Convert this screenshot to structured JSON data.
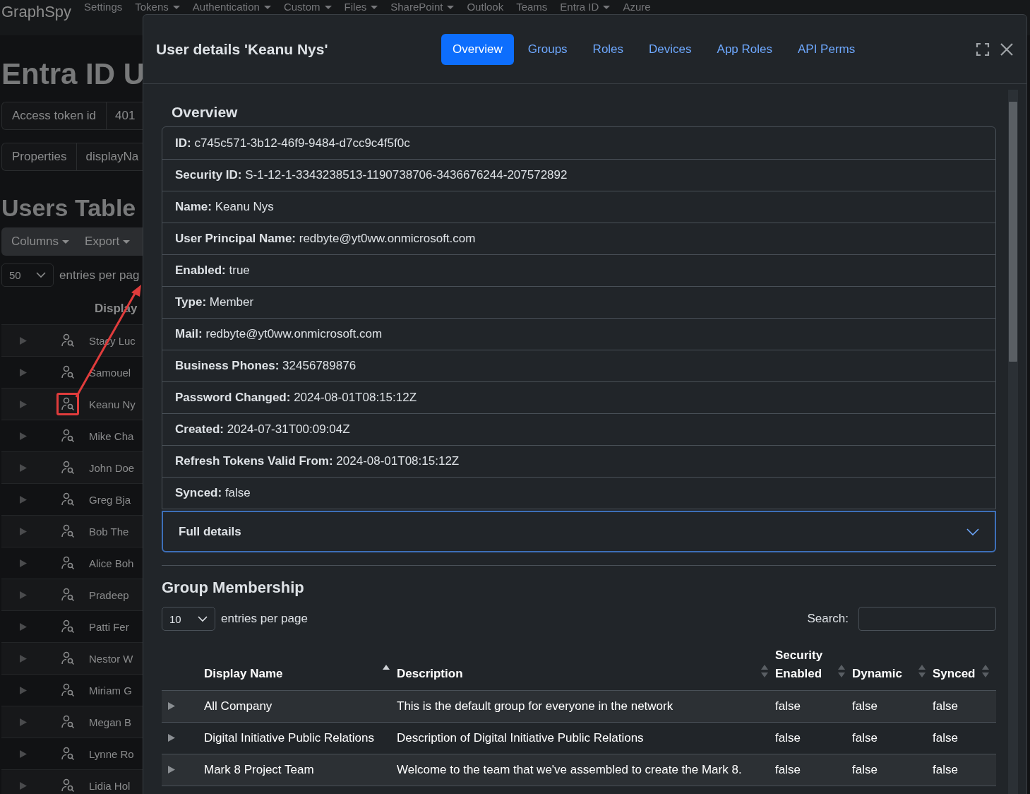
{
  "navbar": {
    "brand": "GraphSpy",
    "items": [
      {
        "label": "Settings",
        "dropdown": false
      },
      {
        "label": "Tokens",
        "dropdown": true
      },
      {
        "label": "Authentication",
        "dropdown": true
      },
      {
        "label": "Custom",
        "dropdown": true
      },
      {
        "label": "Files",
        "dropdown": true
      },
      {
        "label": "SharePoint",
        "dropdown": true
      },
      {
        "label": "Outlook",
        "dropdown": false
      },
      {
        "label": "Teams",
        "dropdown": false
      },
      {
        "label": "Entra ID",
        "dropdown": true
      },
      {
        "label": "Azure",
        "dropdown": false
      }
    ]
  },
  "page": {
    "title": "Entra ID U",
    "token_group": {
      "label": "Access token id",
      "value": "401"
    },
    "properties_group": {
      "label": "Properties",
      "value": "displayNa"
    },
    "users_heading": "Users Table",
    "toolbar": [
      "Columns",
      "Export"
    ],
    "page_size": "50",
    "entries_label": "entries per pag",
    "column_header": "Display",
    "users": [
      {
        "name": "Stacy Luc",
        "highlighted": false
      },
      {
        "name": "Samouel",
        "highlighted": false
      },
      {
        "name": "Keanu Ny",
        "highlighted": true
      },
      {
        "name": "Mike Cha",
        "highlighted": false
      },
      {
        "name": "John Doe",
        "highlighted": false
      },
      {
        "name": "Greg Bja",
        "highlighted": false
      },
      {
        "name": "Bob The",
        "highlighted": false
      },
      {
        "name": "Alice Boh",
        "highlighted": false
      },
      {
        "name": "Pradeep",
        "highlighted": false
      },
      {
        "name": "Patti Fer",
        "highlighted": false
      },
      {
        "name": "Nestor W",
        "highlighted": false
      },
      {
        "name": "Miriam G",
        "highlighted": false
      },
      {
        "name": "Megan B",
        "highlighted": false
      },
      {
        "name": "Lynne Ro",
        "highlighted": false
      },
      {
        "name": "Lidia Hol",
        "highlighted": false
      }
    ]
  },
  "modal": {
    "title": "User details 'Keanu Nys'",
    "tabs": [
      {
        "label": "Overview",
        "selected": true
      },
      {
        "label": "Groups",
        "selected": false
      },
      {
        "label": "Roles",
        "selected": false
      },
      {
        "label": "Devices",
        "selected": false
      },
      {
        "label": "App Roles",
        "selected": false
      },
      {
        "label": "API Perms",
        "selected": false
      }
    ],
    "overview": {
      "heading": "Overview",
      "fields": [
        {
          "label": "ID:",
          "value": "c745c571-3b12-46f9-9484-d7cc9c4f5f0c"
        },
        {
          "label": "Security ID:",
          "value": "S-1-12-1-3343238513-1190738706-3436676244-207572892"
        },
        {
          "label": "Name:",
          "value": "Keanu Nys"
        },
        {
          "label": "User Principal Name:",
          "value": "redbyte@yt0ww.onmicrosoft.com"
        },
        {
          "label": "Enabled:",
          "value": "true"
        },
        {
          "label": "Type:",
          "value": "Member"
        },
        {
          "label": "Mail:",
          "value": "redbyte@yt0ww.onmicrosoft.com"
        },
        {
          "label": "Business Phones:",
          "value": "32456789876"
        },
        {
          "label": "Password Changed:",
          "value": "2024-08-01T08:15:12Z"
        },
        {
          "label": "Created:",
          "value": "2024-07-31T00:09:04Z"
        },
        {
          "label": "Refresh Tokens Valid From:",
          "value": "2024-08-01T08:15:12Z"
        },
        {
          "label": "Synced:",
          "value": "false"
        }
      ]
    },
    "accordion": {
      "label": "Full details",
      "expanded": false
    },
    "groups": {
      "heading": "Group Membership",
      "page_size": "10",
      "entries_label": "entries per page",
      "search_label": "Search:",
      "columns": [
        {
          "label": "Display Name",
          "sorted": true
        },
        {
          "label": "Description",
          "sorted": false
        },
        {
          "label": "Security Enabled",
          "sorted": false
        },
        {
          "label": "Dynamic",
          "sorted": false
        },
        {
          "label": "Synced",
          "sorted": false
        }
      ],
      "rows": [
        [
          "All Company",
          "This is the default group for everyone in the network",
          "false",
          "false",
          "false"
        ],
        [
          "Digital Initiative Public Relations",
          "Description of Digital Initiative Public Relations",
          "false",
          "false",
          "false"
        ],
        [
          "Mark 8 Project Team",
          "Welcome to the team that we've assembled to create the Mark 8.",
          "false",
          "false",
          "false"
        ]
      ]
    }
  }
}
